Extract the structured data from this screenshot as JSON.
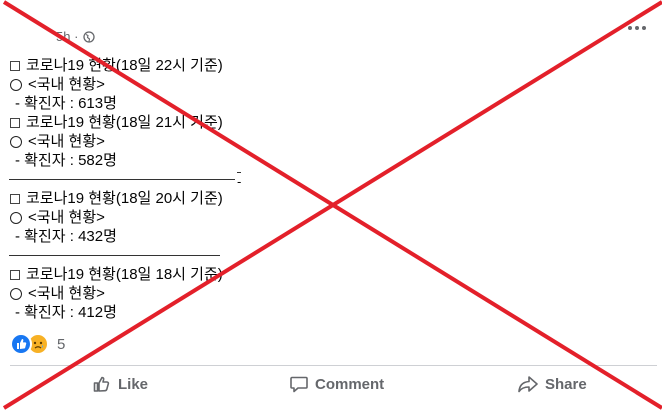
{
  "post": {
    "time": "5h",
    "separator": "·",
    "body": {
      "blocks": [
        {
          "headline": "코로나19 현황(18일 22시 기준)",
          "subhead": "<국내 현황>",
          "stat": "- 확진자 : 613명"
        },
        {
          "headline": "코로나19 현황(18일 21시 기준)",
          "subhead": "<국내 현황>",
          "stat": "- 확진자 : 582명"
        },
        {
          "headline": "코로나19 현황(18일 20시 기준)",
          "subhead": "<국내 현황>",
          "stat": "- 확진자 : 432명"
        },
        {
          "headline": "코로나19 현황(18일 18시 기준)",
          "subhead": "<국내 현황>",
          "stat": "- 확진자 : 412명"
        }
      ],
      "trailing_dash": "-"
    },
    "reactions": {
      "count": "5"
    },
    "actions": {
      "like": "Like",
      "comment": "Comment",
      "share": "Share"
    }
  },
  "colors": {
    "overlay_x": "#e3202a",
    "accent": "#1877f2",
    "muted": "#65676b"
  }
}
